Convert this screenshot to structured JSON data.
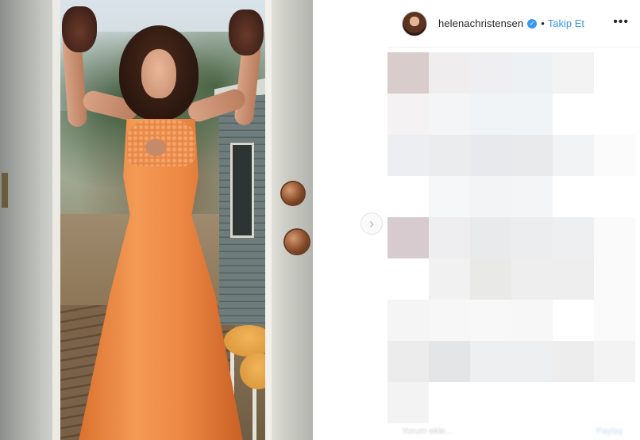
{
  "post": {
    "username": "helenachristensen",
    "verified": true,
    "separator": "•",
    "follow_label": "Takip Et",
    "more_icon": "more-horizontal-icon",
    "nav_icon": "chevron-right-icon",
    "footer_left": "Yorum ekle...",
    "footer_right": "Paylaş"
  },
  "colors": {
    "accent": "#3897f0",
    "text": "#262626",
    "border": "#efefef"
  },
  "mosaic_colors": [
    [
      "#d8cccc",
      "#efedee",
      "#efeef0",
      "#eef1f4",
      "#f3f3f3",
      "#ffffff"
    ],
    [
      "#f4f2f2",
      "#f3f5f7",
      "#f0f4f7",
      "#f1f4f6",
      "#ffffff",
      "#ffffff"
    ],
    [
      "#eceef1",
      "#eaecee",
      "#e8e9ec",
      "#e9eaec",
      "#f2f3f5",
      "#fbfbfb"
    ],
    [
      "#ffffff",
      "#f6f7f8",
      "#f3f4f5",
      "#f4f5f6",
      "#ffffff",
      "#ffffff"
    ],
    [
      "#d7cbcf",
      "#eeeef0",
      "#e9eaeb",
      "#ecedee",
      "#eeeff0",
      "#fafafa"
    ],
    [
      "#ffffff",
      "#f1f1f1",
      "#e9e9e7",
      "#eeeeee",
      "#eeeeee",
      "#fafafa"
    ],
    [
      "#f5f5f5",
      "#f7f7f7",
      "#f8f8f8",
      "#f7f7f7",
      "#ffffff",
      "#fafafa"
    ],
    [
      "#ececed",
      "#e4e5e7",
      "#eeeff0",
      "#eeeff0",
      "#ededee",
      "#f3f3f4"
    ],
    [
      "#f3f3f3",
      "#ffffff",
      "#ffffff",
      "#ffffff",
      "#ffffff",
      "#ffffff"
    ]
  ]
}
